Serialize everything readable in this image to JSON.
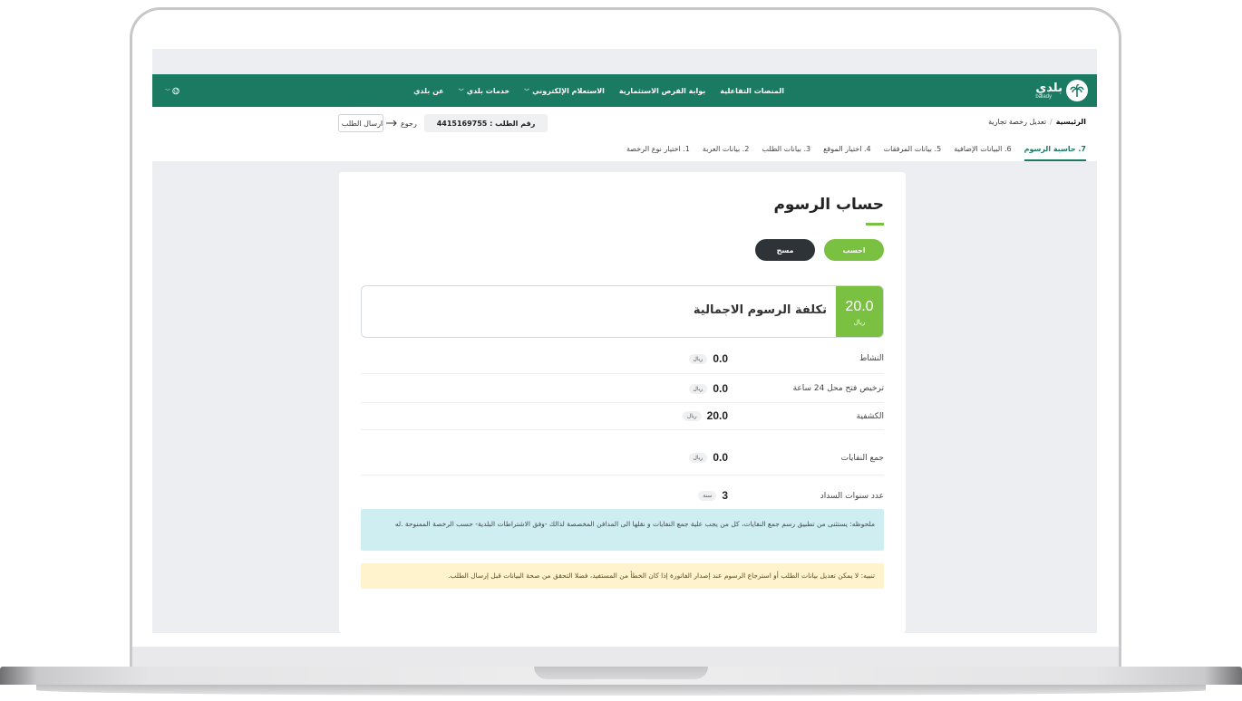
{
  "header": {
    "logo_ar": "بلدي",
    "logo_en": "balady",
    "nav": [
      {
        "label": "عن بلدي",
        "has_dropdown": false
      },
      {
        "label": "خدمات بلدي",
        "has_dropdown": true
      },
      {
        "label": "الاستعلام الإلكتروني",
        "has_dropdown": true
      },
      {
        "label": "بوابة الفرص الاستثمارية",
        "has_dropdown": false
      },
      {
        "label": "المنصات التفاعلية",
        "has_dropdown": false
      }
    ]
  },
  "breadcrumb": {
    "home": "الرئيسية",
    "separator": "/",
    "current": "تعديل رخصة تجارية"
  },
  "request": {
    "number_text": "رقم الطلب : 4415169755",
    "back_label": "رجوع",
    "send_label": "ارسال الطلب"
  },
  "steps": [
    {
      "label": "1. اختيار نوع الرخصة",
      "active": false
    },
    {
      "label": "2. بيانات العربة",
      "active": false
    },
    {
      "label": "3. بيانات الطلب",
      "active": false
    },
    {
      "label": "4. اختيار الموقع",
      "active": false
    },
    {
      "label": "5. بيانات المرفقات",
      "active": false
    },
    {
      "label": "6. البيانات الإضافية",
      "active": false
    },
    {
      "label": "7. حاسبة الرسوم",
      "active": true
    }
  ],
  "card": {
    "title": "حساب الرسوم",
    "calc_label": "احسب",
    "clear_label": "مسح",
    "total": {
      "value": "20.0",
      "unit": "ريال",
      "label": "تكلفة الرسوم الاجمالية"
    },
    "fees": [
      {
        "label": "النشاط",
        "value": "0.0",
        "unit": "ريال"
      },
      {
        "label": "ترخيص فتح محل 24 ساعة",
        "value": "0.0",
        "unit": "ريال"
      },
      {
        "label": "الكشفية",
        "value": "20.0",
        "unit": "ريال"
      },
      {
        "label": "جمع النفايات",
        "value": "0.0",
        "unit": "ريال"
      },
      {
        "label": "عدد سنوات السداد",
        "value": "3",
        "unit": "سنة"
      }
    ],
    "note_info": "ملحوظه: يستثنى من تطبيق رسم جمع النفايات، كل من يجب علية جمع النفايات و نقلها الى المدافن المخصصة لذالك -وفق الاشتراطات البلدية- حسب الرخصة الممنوحة .له",
    "note_warning": "تنبيه: لا يمكن تعديل بيانات الطلب أو استرجاع الرسوم عند إصدار الفاتورة إذا كان الخطأ من المستفيد، فضلا التحقق من صحة البيانات قبل إرسال الطلب."
  },
  "colors": {
    "primary": "#1b7a62",
    "accent": "#7ac142",
    "dark_button": "#2e3338",
    "info_bg": "#cfeef2",
    "warning_bg": "#fff3cd"
  }
}
